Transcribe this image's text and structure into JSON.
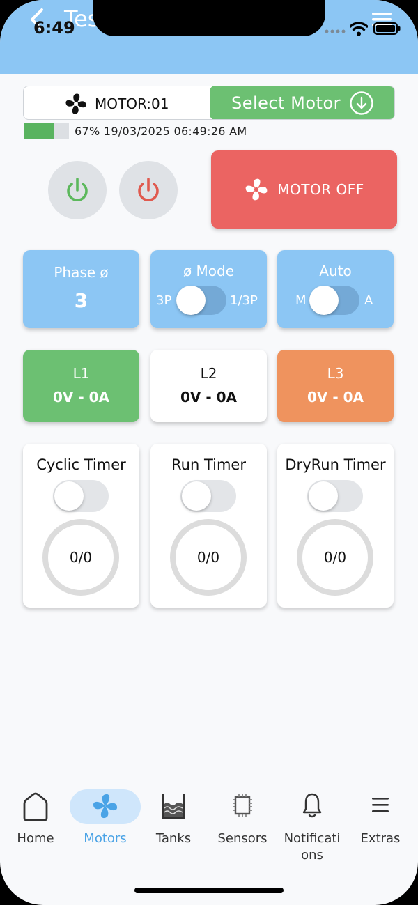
{
  "status_bar": {
    "time": "6:49"
  },
  "app_bar": {
    "title": "Tes"
  },
  "motor_header": {
    "motor_label": "MOTOR:01",
    "select_button_label": "Select Motor"
  },
  "signal": {
    "strength_percent": 67,
    "strength_text": "67%",
    "timestamp": "19/03/2025 06:49:26 AM"
  },
  "motor_status": {
    "label": "MOTOR OFF"
  },
  "phase_card": {
    "label": "Phase ø",
    "value": "3"
  },
  "mode_card": {
    "label": "ø Mode",
    "left_option": "3P",
    "right_option": "1/3P"
  },
  "auto_card": {
    "label": "Auto",
    "left_option": "M",
    "right_option": "A"
  },
  "lines": [
    {
      "label": "L1",
      "value": "0V - 0A",
      "color": "#6cc072"
    },
    {
      "label": "L2",
      "value": "0V - 0A",
      "color": "#ffffff"
    },
    {
      "label": "L3",
      "value": "0V - 0A",
      "color": "#ef935e"
    }
  ],
  "timers": [
    {
      "title": "Cyclic Timer",
      "value": "0/0"
    },
    {
      "title": "Run Timer",
      "value": "0/0"
    },
    {
      "title": "DryRun Timer",
      "value": "0/0"
    }
  ],
  "nav": [
    {
      "label": "Home",
      "icon": "home-icon"
    },
    {
      "label": "Motors",
      "icon": "fan-icon",
      "active": true
    },
    {
      "label": "Tanks",
      "icon": "tank-icon"
    },
    {
      "label": "Sensors",
      "icon": "chip-icon"
    },
    {
      "label": "Notificati\nons",
      "label_line1": "Notificati",
      "label_line2": "ons",
      "icon": "bell-icon"
    },
    {
      "label": "Extras",
      "icon": "menu-icon"
    }
  ],
  "colors": {
    "app_bar": "#8cc6f4",
    "accent_green": "#6cc072",
    "motor_off_red": "#eb6462",
    "power_on_green": "#5cb85c",
    "power_off_red": "#e05a4f",
    "active_nav": "#4aa3e6"
  }
}
